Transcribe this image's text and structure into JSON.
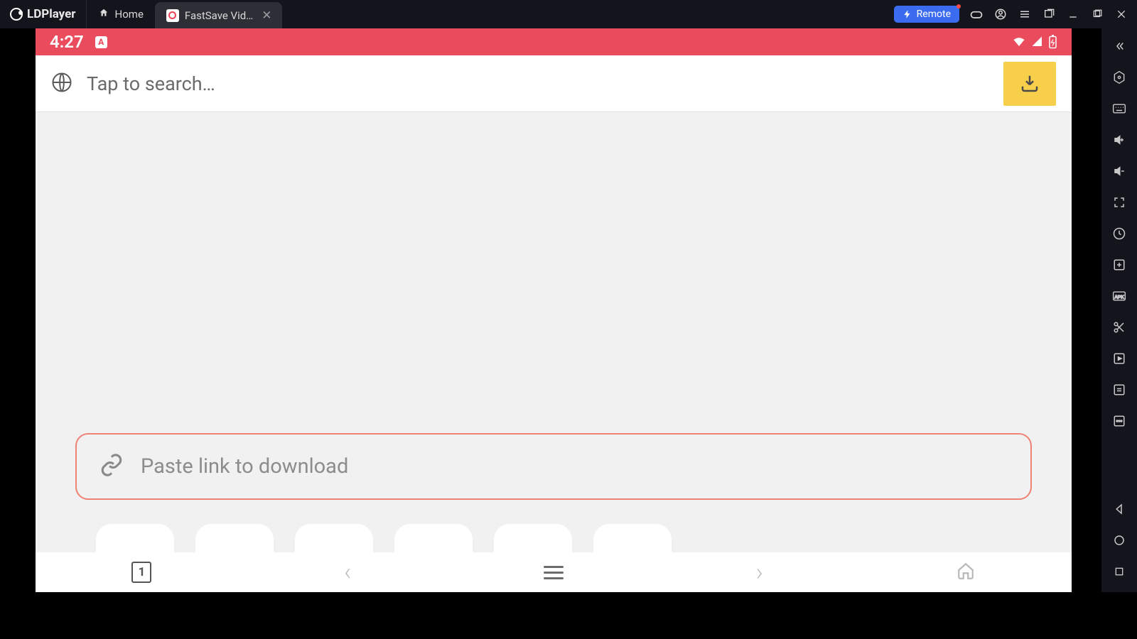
{
  "emulator": {
    "brand": "LDPlayer",
    "tabs": {
      "home": "Home",
      "active": "FastSave Vid…"
    },
    "remote_label": "Remote"
  },
  "status": {
    "time": "4:27",
    "indicator": "A"
  },
  "search": {
    "placeholder": "Tap to search…"
  },
  "paste": {
    "placeholder": "Paste link to download"
  },
  "bottom_nav": {
    "tab_count": "1"
  },
  "icons": {
    "globe": "globe-icon",
    "download_tray": "download-tray-icon",
    "link": "link-icon",
    "home": "home-icon",
    "back": "chevron-left-icon",
    "forward": "chevron-right-icon",
    "menu": "menu-icon",
    "home_nav": "home-outline-icon"
  }
}
